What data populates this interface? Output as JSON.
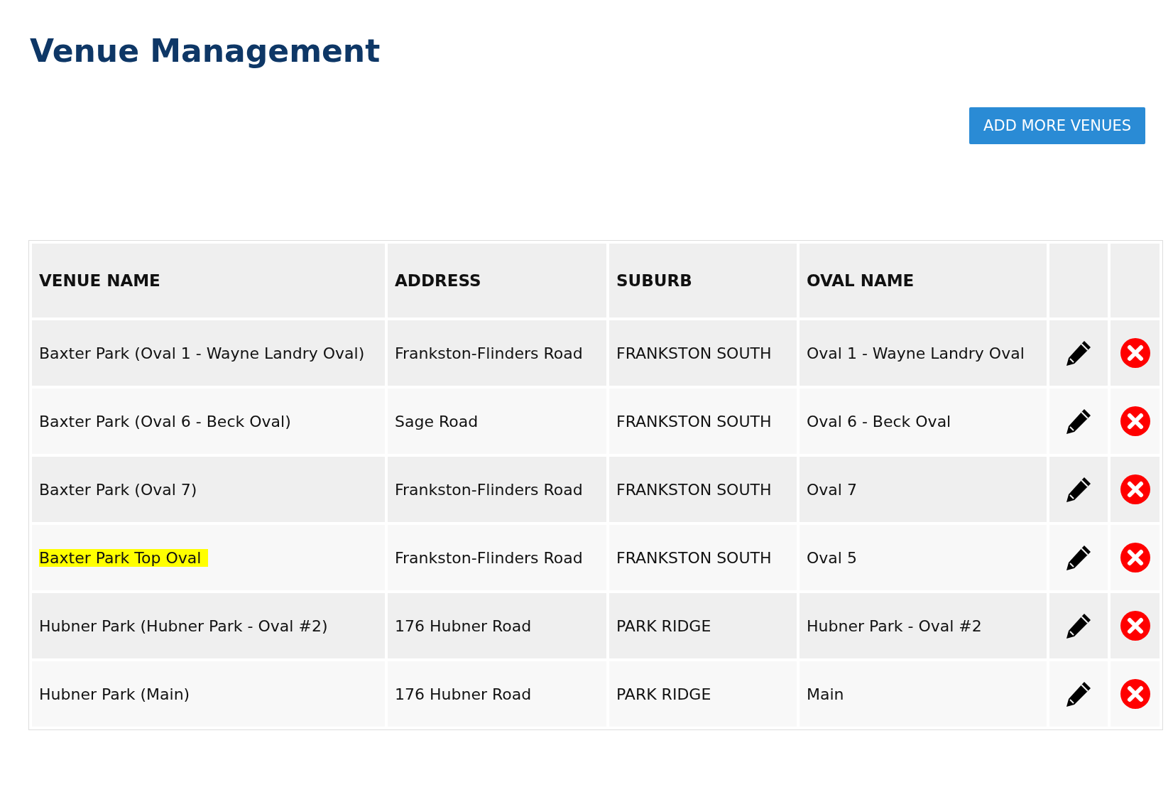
{
  "page": {
    "title": "Venue Management"
  },
  "add_button": {
    "label": "ADD MORE VENUES"
  },
  "table": {
    "columns": [
      "VENUE NAME",
      "ADDRESS",
      "SUBURB",
      "OVAL NAME"
    ],
    "rows": [
      {
        "venue_name": "Baxter Park (Oval 1 - Wayne Landry Oval)",
        "address": "Frankston-Flinders Road",
        "suburb": "FRANKSTON SOUTH",
        "oval_name": "Oval 1 - Wayne Landry Oval",
        "highlighted": false
      },
      {
        "venue_name": "Baxter Park (Oval 6 - Beck Oval)",
        "address": "Sage Road",
        "suburb": "FRANKSTON SOUTH",
        "oval_name": "Oval 6 - Beck Oval",
        "highlighted": false
      },
      {
        "venue_name": "Baxter Park (Oval 7)",
        "address": "Frankston-Flinders Road",
        "suburb": "FRANKSTON SOUTH",
        "oval_name": "Oval 7",
        "highlighted": false
      },
      {
        "venue_name": "Baxter Park Top Oval",
        "address": "Frankston-Flinders Road",
        "suburb": "FRANKSTON SOUTH",
        "oval_name": "Oval 5",
        "highlighted": true
      },
      {
        "venue_name": "Hubner Park (Hubner Park - Oval #2)",
        "address": "176 Hubner Road",
        "suburb": "PARK RIDGE",
        "oval_name": "Hubner Park - Oval #2",
        "highlighted": false
      },
      {
        "venue_name": "Hubner Park (Main)",
        "address": "176 Hubner Road",
        "suburb": "PARK RIDGE",
        "oval_name": "Main",
        "highlighted": false
      }
    ]
  }
}
